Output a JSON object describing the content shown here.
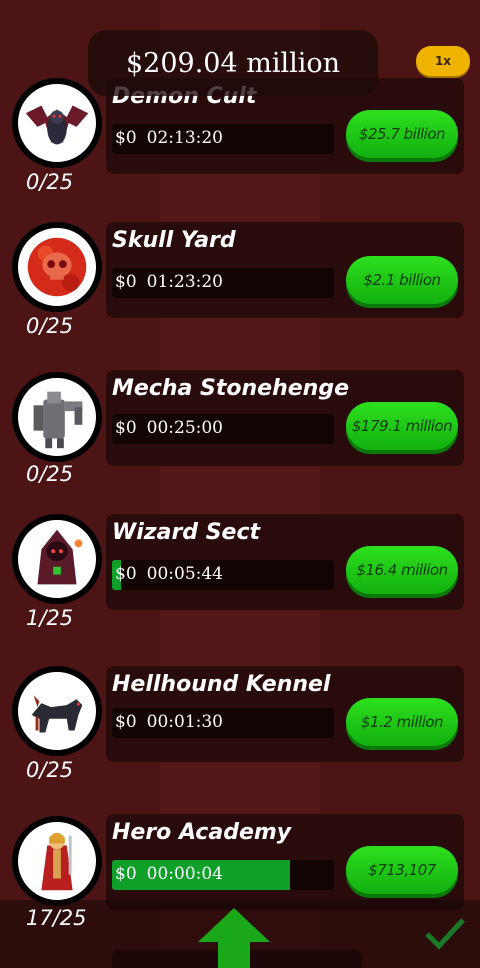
{
  "balance": "$209.04 million",
  "speed_badge": "1x",
  "businesses": [
    {
      "name": "Demon Cult",
      "income": "$0",
      "timer": "02:13:20",
      "price": "$25.7 billion",
      "count": "0/25",
      "progress": 0,
      "icon": "demon-bat-icon"
    },
    {
      "name": "Skull Yard",
      "income": "$0",
      "timer": "01:23:20",
      "price": "$2.1 billion",
      "count": "0/25",
      "progress": 0,
      "icon": "skull-icon"
    },
    {
      "name": "Mecha Stonehenge",
      "income": "$0",
      "timer": "00:25:00",
      "price": "$179.1 million",
      "count": "0/25",
      "progress": 0,
      "icon": "stone-golem-icon"
    },
    {
      "name": "Wizard Sect",
      "income": "$0",
      "timer": "00:05:44",
      "price": "$16.4 million",
      "count": "1/25",
      "progress": 0.04,
      "icon": "wizard-icon"
    },
    {
      "name": "Hellhound Kennel",
      "income": "$0",
      "timer": "00:01:30",
      "price": "$1.2 million",
      "count": "0/25",
      "progress": 0,
      "icon": "hellhound-icon"
    },
    {
      "name": "Hero Academy",
      "income": "$0",
      "timer": "00:00:04",
      "price": "$713,107",
      "count": "17/25",
      "progress": 0.8,
      "icon": "hero-icon"
    }
  ],
  "colors": {
    "background": "#4e1515",
    "panel": "#2a0b0b",
    "buy_button": "#1cc418",
    "progress_fill": "#0fa02a",
    "speed_badge": "#f0b400"
  }
}
